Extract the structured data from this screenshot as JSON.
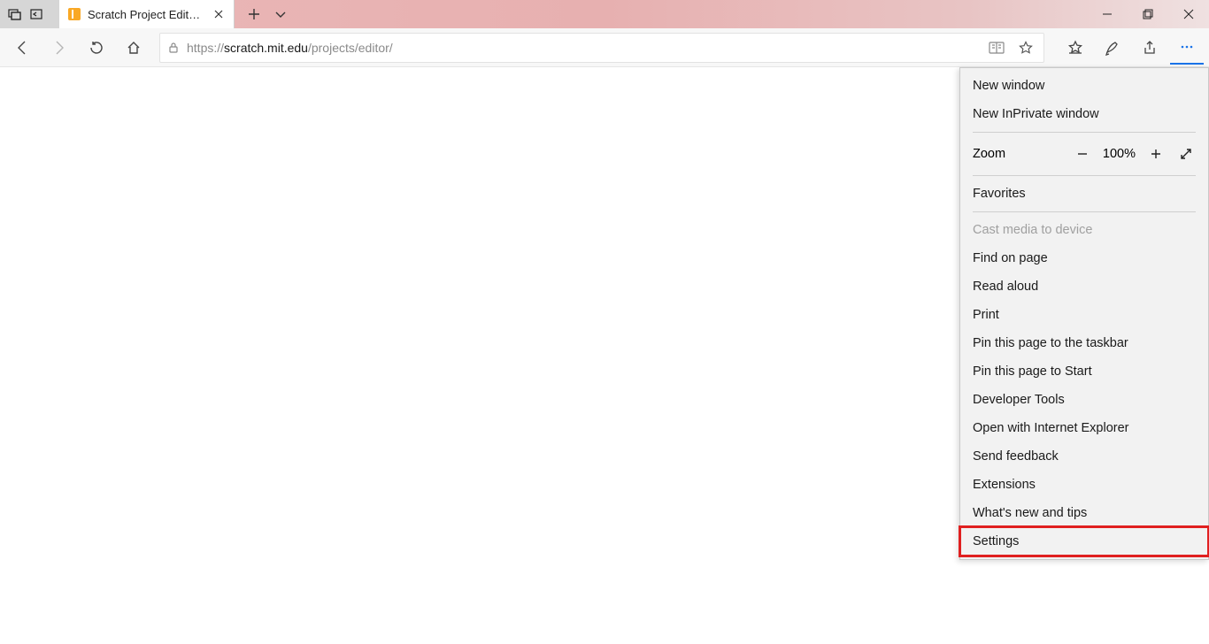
{
  "tab": {
    "title": "Scratch Project Editor -"
  },
  "address": {
    "scheme": "https://",
    "domain": "scratch.mit.edu",
    "path": "/projects/editor/"
  },
  "menu": {
    "new_window": "New window",
    "new_inprivate": "New InPrivate window",
    "zoom_label": "Zoom",
    "zoom_value": "100%",
    "favorites": "Favorites",
    "cast": "Cast media to device",
    "find": "Find on page",
    "read_aloud": "Read aloud",
    "print": "Print",
    "pin_taskbar": "Pin this page to the taskbar",
    "pin_start": "Pin this page to Start",
    "devtools": "Developer Tools",
    "open_ie": "Open with Internet Explorer",
    "feedback": "Send feedback",
    "extensions": "Extensions",
    "whatsnew": "What's new and tips",
    "settings": "Settings"
  }
}
